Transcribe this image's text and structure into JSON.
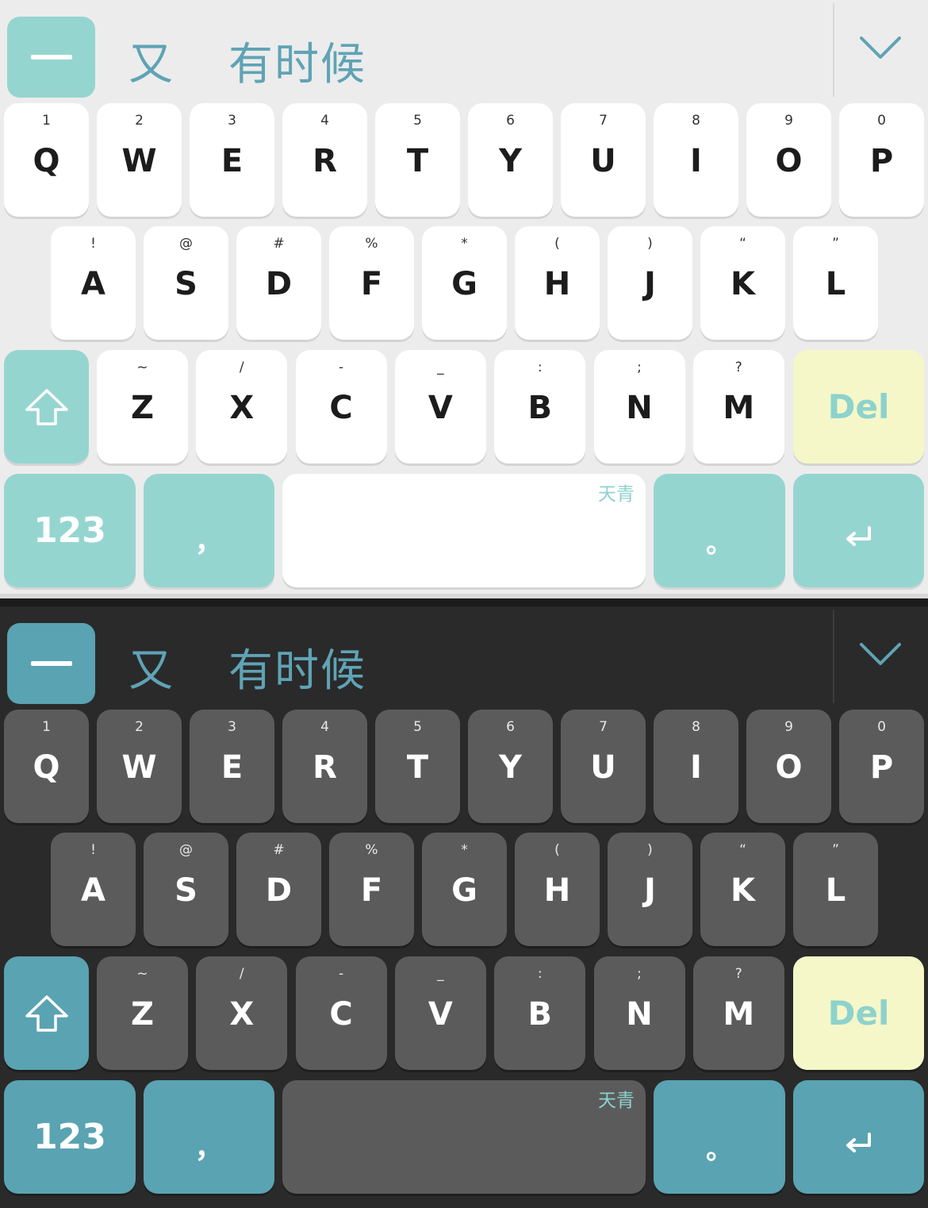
{
  "candidate_bar": {
    "collapse_icon": "minus-icon",
    "candidates": [
      "又",
      "有时候"
    ],
    "expand_icon": "chevron-down-icon"
  },
  "rows": {
    "top": [
      {
        "hint": "1",
        "label": "Q"
      },
      {
        "hint": "2",
        "label": "W"
      },
      {
        "hint": "3",
        "label": "E"
      },
      {
        "hint": "4",
        "label": "R"
      },
      {
        "hint": "5",
        "label": "T"
      },
      {
        "hint": "6",
        "label": "Y"
      },
      {
        "hint": "7",
        "label": "U"
      },
      {
        "hint": "8",
        "label": "I"
      },
      {
        "hint": "9",
        "label": "O"
      },
      {
        "hint": "0",
        "label": "P"
      }
    ],
    "middle": [
      {
        "hint": "!",
        "label": "A"
      },
      {
        "hint": "@",
        "label": "S"
      },
      {
        "hint": "#",
        "label": "D"
      },
      {
        "hint": "%",
        "label": "F"
      },
      {
        "hint": "*",
        "label": "G"
      },
      {
        "hint": "(",
        "label": "H"
      },
      {
        "hint": ")",
        "label": "J"
      },
      {
        "hint": "“",
        "label": "K"
      },
      {
        "hint": "”",
        "label": "L"
      }
    ],
    "bottom": [
      {
        "hint": "~",
        "label": "Z"
      },
      {
        "hint": "/",
        "label": "X"
      },
      {
        "hint": "-",
        "label": "C"
      },
      {
        "hint": "_",
        "label": "V"
      },
      {
        "hint": ":",
        "label": "B"
      },
      {
        "hint": ";",
        "label": "N"
      },
      {
        "hint": "?",
        "label": "M"
      }
    ]
  },
  "keys": {
    "shift_icon": "shift-arrow-icon",
    "delete_label": "Del",
    "numbers_label": "123",
    "comma_label": "，",
    "space_brand": "天青",
    "period_label": "。",
    "enter_icon": "enter-return-icon"
  },
  "colors": {
    "light_accent": "#95d5d0",
    "dark_accent": "#5aa3b2",
    "delete_bg": "#f5f7c8",
    "candidate_text": "#5fa3b5"
  },
  "themes": [
    "light",
    "dark"
  ]
}
